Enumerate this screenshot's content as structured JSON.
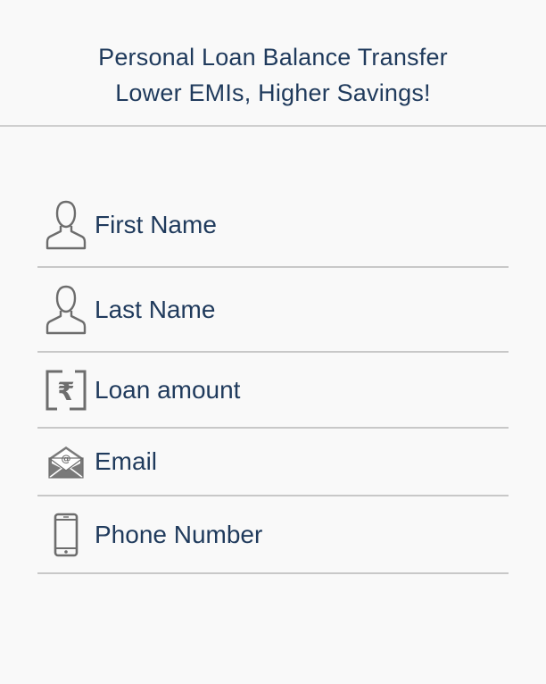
{
  "header": {
    "line1": "Personal Loan Balance Transfer",
    "line2": "Lower EMIs, Higher Savings!"
  },
  "form": {
    "fields": [
      {
        "label": "First Name",
        "icon": "user-icon"
      },
      {
        "label": "Last Name",
        "icon": "user-icon"
      },
      {
        "label": "Loan amount",
        "icon": "rupee-icon"
      },
      {
        "label": "Email",
        "icon": "email-icon"
      },
      {
        "label": "Phone Number",
        "icon": "phone-icon"
      }
    ]
  },
  "icons": {
    "rupee_symbol": "₹",
    "email_at": "@"
  },
  "colors": {
    "text": "#1f3a5c",
    "icon": "#6d6d6d",
    "divider": "#c8c8c8",
    "background": "#f9f9f9"
  }
}
